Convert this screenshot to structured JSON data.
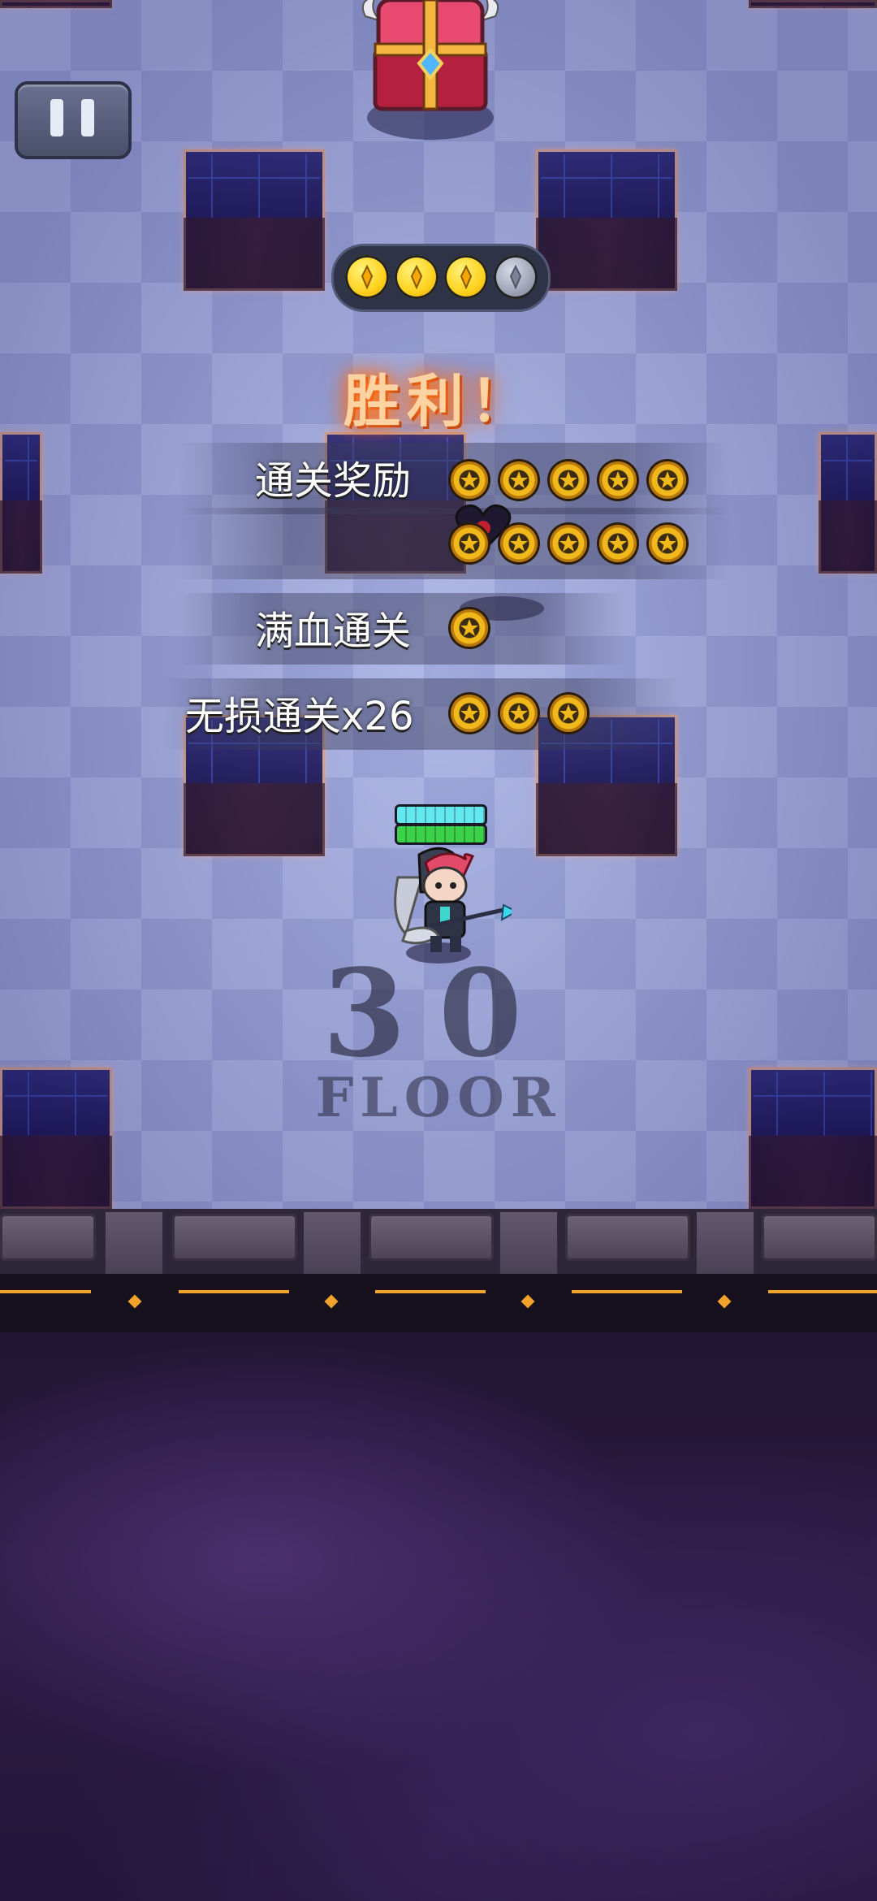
{
  "hud": {
    "pause_icon": "pause-icon",
    "chest_icon": "treasure-chest-icon"
  },
  "stage_progress": {
    "collected": 3,
    "total": 4
  },
  "result": {
    "title": "胜利！",
    "rows": [
      {
        "label": "通关奖励",
        "medals": 10
      },
      {
        "label": "满血通关",
        "medals": 1
      },
      {
        "label": "无损通关x26",
        "medals": 3
      }
    ]
  },
  "floor": {
    "number": "30",
    "word": "FLOOR"
  },
  "colors": {
    "victory_glow": "#ff7a20",
    "medal_gold": "#f1b81c",
    "shield_bar": "#64e8ef",
    "health_bar": "#3bd24a",
    "ledge_accent": "#f0a22b"
  }
}
